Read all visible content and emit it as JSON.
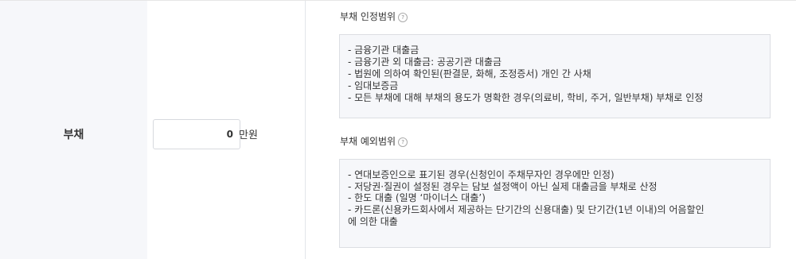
{
  "row": {
    "label": "부채",
    "amount": {
      "value": "0",
      "unit": "만원"
    }
  },
  "recognized": {
    "title": "부채 인정범위",
    "icon": "help-circle-icon",
    "lines": [
      "- 금융기관 대출금",
      "- 금융기관 외 대출금: 공공기관 대출금",
      "- 법원에 의하여 확인된(판결문, 화해, 조정증서) 개인 간 사채",
      "- 임대보증금",
      "- 모든 부채에 대해 부채의 용도가 명확한 경우(의료비, 학비, 주거, 일반부채) 부채로 인정"
    ]
  },
  "excluded": {
    "title": "부채 예외범위",
    "icon": "help-circle-icon",
    "lines": [
      "- 연대보증인으로 표기된 경우(신청인이 주채무자인 경우에만 인정)",
      "- 저당권·질권이 설정된 경우는 담보 설정액이 아닌 실제 대출금을 부채로 산정",
      "- 한도 대출 (일명 ‘마이너스 대출’)",
      "- 카드론(신용카드회사에서 제공하는 단기간의 신용대출) 및 단기간(1년 이내)의 어음할인",
      "에 의한 대출"
    ]
  }
}
